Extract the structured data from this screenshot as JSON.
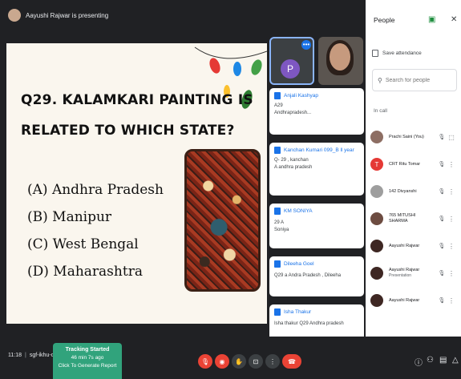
{
  "presenting": {
    "text": "Aayushi Rajwar is presenting"
  },
  "slide": {
    "title_line1": "Q29. KALAMKARI PAINTING IS",
    "title_line2": "RELATED TO WHICH STATE?",
    "options": [
      "(A) Andhra Pradesh",
      "(B) Manipur",
      "(C) West Bengal",
      "(D) Maharashtra"
    ]
  },
  "tiles": {
    "avatar_letter": "P"
  },
  "chat": [
    {
      "name": "Anjali Kashyap",
      "lines": [
        "A29",
        "Andhrapradesh..."
      ]
    },
    {
      "name": "Kanchan Kumari 099_B ll year",
      "lines": [
        "Q- 29 , kanchan",
        "A andhra pradesh"
      ]
    },
    {
      "name": "KM SONIYA",
      "lines": [
        "29 A",
        "Soniya"
      ]
    },
    {
      "name": "Dileeha Goel",
      "lines": [
        "Q29 a  Andra Pradesh , Dileeha"
      ]
    },
    {
      "name": "Isha Thakur",
      "lines": [
        "Isha thakur Q29 Andhra pradesh"
      ]
    }
  ],
  "people": {
    "title": "People",
    "save_attendance": "Save attendance",
    "search_placeholder": "Search for people",
    "in_call": "In call",
    "list": [
      {
        "name": "Prachi Saini (You)",
        "sub": "",
        "color": "#8d6e63",
        "letter": "",
        "mic": "🎙",
        "more": "⬚"
      },
      {
        "name": "CRT Ritu Tomar",
        "sub": "",
        "color": "#e53935",
        "letter": "T",
        "mic": "🎙",
        "more": "⋮"
      },
      {
        "name": "142 Divyanshi",
        "sub": "",
        "color": "#9e9e9e",
        "letter": "",
        "mic": "🎙",
        "more": "⋮"
      },
      {
        "name": "765 MITUSHI SHARMA",
        "sub": "",
        "color": "#6d4c41",
        "letter": "",
        "mic": "🎙",
        "more": "⋮"
      },
      {
        "name": "Aayushi Rajwar",
        "sub": "",
        "color": "#3e2723",
        "letter": "",
        "mic": "🎙",
        "more": "⋮"
      },
      {
        "name": "Aayushi Rajwar",
        "sub": "Presentation",
        "color": "#3e2723",
        "letter": "",
        "mic": "🎙",
        "more": "⋮"
      },
      {
        "name": "Aayushi Rajwar",
        "sub": "",
        "color": "#3e2723",
        "letter": "",
        "mic": "🎙",
        "more": "⋮"
      }
    ]
  },
  "bottom": {
    "time": "11:18",
    "meeting_code": "sgf-ikhu-ong",
    "tracking_title": "Tracking Started",
    "tracking_ago": "46 min 7s ago",
    "tracking_report": "Click To Generate Report"
  }
}
